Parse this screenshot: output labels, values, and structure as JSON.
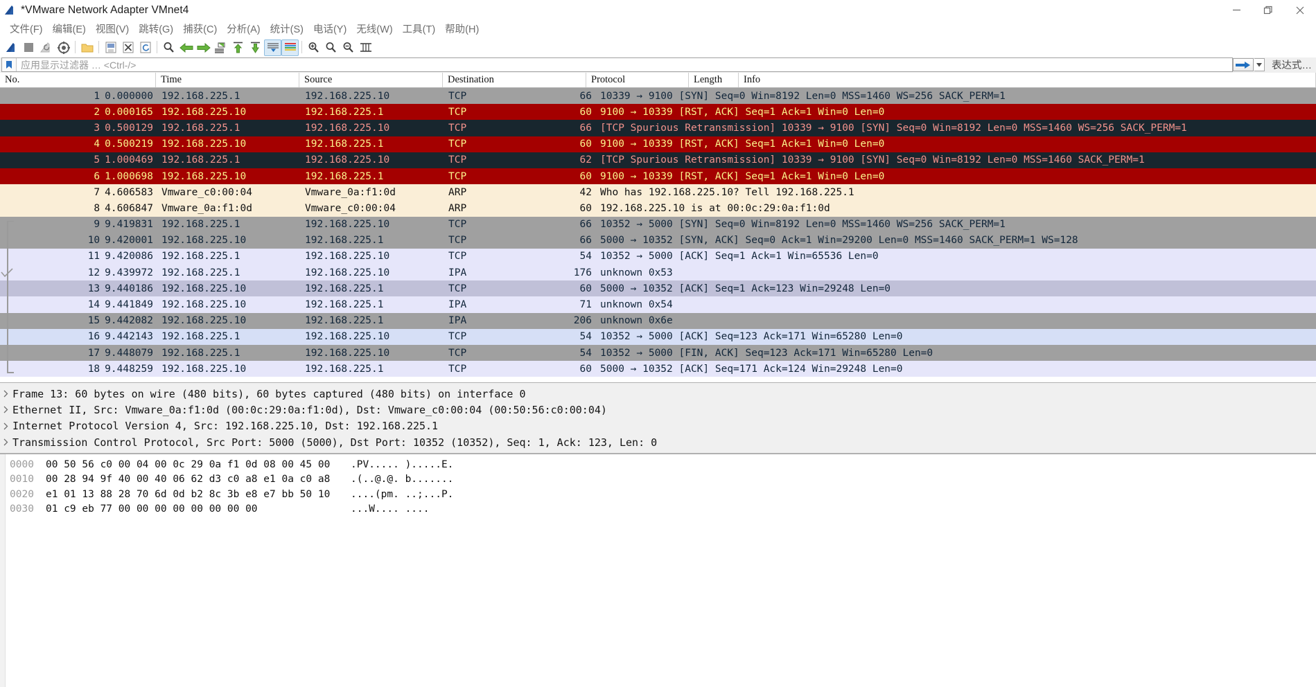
{
  "window": {
    "title": "*VMware Network Adapter VMnet4",
    "minimize_label": "minimize-icon",
    "restore_label": "restore-icon",
    "close_label": "close-icon"
  },
  "menu": {
    "items": [
      {
        "label": "文件(F)"
      },
      {
        "label": "编辑(E)"
      },
      {
        "label": "视图(V)"
      },
      {
        "label": "跳转(G)"
      },
      {
        "label": "捕获(C)"
      },
      {
        "label": "分析(A)"
      },
      {
        "label": "统计(S)"
      },
      {
        "label": "电话(Y)"
      },
      {
        "label": "无线(W)"
      },
      {
        "label": "工具(T)"
      },
      {
        "label": "帮助(H)"
      }
    ]
  },
  "toolbar": {
    "buttons": [
      {
        "name": "start-capture-icon"
      },
      {
        "name": "stop-capture-icon"
      },
      {
        "name": "restart-capture-icon"
      },
      {
        "name": "capture-options-icon"
      },
      {
        "name": "open-file-icon"
      },
      {
        "name": "save-file-icon"
      },
      {
        "name": "close-file-icon"
      },
      {
        "name": "reload-file-icon"
      },
      {
        "name": "find-packet-icon"
      },
      {
        "name": "go-back-icon"
      },
      {
        "name": "go-forward-icon"
      },
      {
        "name": "go-to-packet-icon"
      },
      {
        "name": "go-to-first-icon"
      },
      {
        "name": "go-to-last-icon"
      },
      {
        "name": "auto-scroll-icon"
      },
      {
        "name": "colorize-icon"
      },
      {
        "name": "zoom-in-icon"
      },
      {
        "name": "zoom-out-icon"
      },
      {
        "name": "zoom-reset-icon"
      },
      {
        "name": "resize-columns-icon"
      }
    ]
  },
  "filter": {
    "placeholder": "应用显示过滤器 … <Ctrl-/>",
    "value": "",
    "expression_label": "表达式…",
    "bookmark_icon": "bookmark-icon",
    "apply_icon": "apply-filter-arrow-icon",
    "dropdown_icon": "chevron-down-icon"
  },
  "packet_list": {
    "columns": [
      {
        "key": "no",
        "label": "No."
      },
      {
        "key": "time",
        "label": "Time"
      },
      {
        "key": "src",
        "label": "Source"
      },
      {
        "key": "dst",
        "label": "Destination"
      },
      {
        "key": "proto",
        "label": "Protocol"
      },
      {
        "key": "len",
        "label": "Length"
      },
      {
        "key": "info",
        "label": "Info"
      }
    ],
    "rows": [
      {
        "no": "1",
        "time": "0.000000",
        "src": "192.168.225.1",
        "dst": "192.168.225.10",
        "proto": "TCP",
        "len": "66",
        "info": "10339 → 9100 [SYN] Seq=0 Win=8192 Len=0 MSS=1460 WS=256 SACK_PERM=1",
        "bg": "#a0a0a0",
        "fg": "#12263a"
      },
      {
        "no": "2",
        "time": "0.000165",
        "src": "192.168.225.10",
        "dst": "192.168.225.1",
        "proto": "TCP",
        "len": "60",
        "info": "9100 → 10339 [RST, ACK] Seq=1 Ack=1 Win=0 Len=0",
        "bg": "#a40000",
        "fg": "#fbf38c"
      },
      {
        "no": "3",
        "time": "0.500129",
        "src": "192.168.225.1",
        "dst": "192.168.225.10",
        "proto": "TCP",
        "len": "66",
        "info": "[TCP Spurious Retransmission] 10339 → 9100 [SYN] Seq=0 Win=8192 Len=0 MSS=1460 WS=256 SACK_PERM=1",
        "bg": "#18262e",
        "fg": "#f2928c"
      },
      {
        "no": "4",
        "time": "0.500219",
        "src": "192.168.225.10",
        "dst": "192.168.225.1",
        "proto": "TCP",
        "len": "60",
        "info": "9100 → 10339 [RST, ACK] Seq=1 Ack=1 Win=0 Len=0",
        "bg": "#a40000",
        "fg": "#fbf38c"
      },
      {
        "no": "5",
        "time": "1.000469",
        "src": "192.168.225.1",
        "dst": "192.168.225.10",
        "proto": "TCP",
        "len": "62",
        "info": "[TCP Spurious Retransmission] 10339 → 9100 [SYN] Seq=0 Win=8192 Len=0 MSS=1460 SACK_PERM=1",
        "bg": "#18262e",
        "fg": "#f2928c"
      },
      {
        "no": "6",
        "time": "1.000698",
        "src": "192.168.225.10",
        "dst": "192.168.225.1",
        "proto": "TCP",
        "len": "60",
        "info": "9100 → 10339 [RST, ACK] Seq=1 Ack=1 Win=0 Len=0",
        "bg": "#a40000",
        "fg": "#fbf38c"
      },
      {
        "no": "7",
        "time": "4.606583",
        "src": "Vmware_c0:00:04",
        "dst": "Vmware_0a:f1:0d",
        "proto": "ARP",
        "len": "42",
        "info": "Who has 192.168.225.10? Tell 192.168.225.1",
        "bg": "#faeed7",
        "fg": "#111111"
      },
      {
        "no": "8",
        "time": "4.606847",
        "src": "Vmware_0a:f1:0d",
        "dst": "Vmware_c0:00:04",
        "proto": "ARP",
        "len": "60",
        "info": "192.168.225.10 is at 00:0c:29:0a:f1:0d",
        "bg": "#faeed7",
        "fg": "#111111"
      },
      {
        "no": "9",
        "time": "9.419831",
        "src": "192.168.225.1",
        "dst": "192.168.225.10",
        "proto": "TCP",
        "len": "66",
        "info": "10352 → 5000 [SYN] Seq=0 Win=8192 Len=0 MSS=1460 WS=256 SACK_PERM=1",
        "bg": "#a0a0a0",
        "fg": "#12263a"
      },
      {
        "no": "10",
        "time": "9.420001",
        "src": "192.168.225.10",
        "dst": "192.168.225.1",
        "proto": "TCP",
        "len": "66",
        "info": "5000 → 10352 [SYN, ACK] Seq=0 Ack=1 Win=29200 Len=0 MSS=1460 SACK_PERM=1 WS=128",
        "bg": "#a0a0a0",
        "fg": "#12263a"
      },
      {
        "no": "11",
        "time": "9.420086",
        "src": "192.168.225.1",
        "dst": "192.168.225.10",
        "proto": "TCP",
        "len": "54",
        "info": "10352 → 5000 [ACK] Seq=1 Ack=1 Win=65536 Len=0",
        "bg": "#e6e6fa",
        "fg": "#12263a"
      },
      {
        "no": "12",
        "time": "9.439972",
        "src": "192.168.225.1",
        "dst": "192.168.225.10",
        "proto": "IPA",
        "len": "176",
        "info": "unknown 0x53",
        "bg": "#e6e6fa",
        "fg": "#12263a"
      },
      {
        "no": "13",
        "time": "9.440186",
        "src": "192.168.225.10",
        "dst": "192.168.225.1",
        "proto": "TCP",
        "len": "60",
        "info": "5000 → 10352 [ACK] Seq=1 Ack=123 Win=29248 Len=0",
        "bg": "#c0c0d8",
        "fg": "#12263a"
      },
      {
        "no": "14",
        "time": "9.441849",
        "src": "192.168.225.10",
        "dst": "192.168.225.1",
        "proto": "IPA",
        "len": "71",
        "info": "unknown 0x54",
        "bg": "#e6e6fa",
        "fg": "#12263a"
      },
      {
        "no": "15",
        "time": "9.442082",
        "src": "192.168.225.10",
        "dst": "192.168.225.1",
        "proto": "IPA",
        "len": "206",
        "info": "unknown 0x6e",
        "bg": "#a0a0a0",
        "fg": "#12263a"
      },
      {
        "no": "16",
        "time": "9.442143",
        "src": "192.168.225.1",
        "dst": "192.168.225.10",
        "proto": "TCP",
        "len": "54",
        "info": "10352 → 5000 [ACK] Seq=123 Ack=171 Win=65280 Len=0",
        "bg": "#d6dff6",
        "fg": "#12263a"
      },
      {
        "no": "17",
        "time": "9.448079",
        "src": "192.168.225.1",
        "dst": "192.168.225.10",
        "proto": "TCP",
        "len": "54",
        "info": "10352 → 5000 [FIN, ACK] Seq=123 Ack=171 Win=65280 Len=0",
        "bg": "#a0a0a0",
        "fg": "#12263a"
      },
      {
        "no": "18",
        "time": "9.448259",
        "src": "192.168.225.10",
        "dst": "192.168.225.1",
        "proto": "TCP",
        "len": "60",
        "info": "5000 → 10352 [ACK] Seq=171 Ack=124 Win=29248 Len=0",
        "bg": "#e6e6fa",
        "fg": "#12263a"
      }
    ]
  },
  "packet_details": {
    "rows": [
      {
        "expander": "collapsed-triangle-icon",
        "text": "Frame 13: 60 bytes on wire (480 bits), 60 bytes captured (480 bits) on interface 0"
      },
      {
        "expander": "collapsed-triangle-icon",
        "text": "Ethernet II, Src: Vmware_0a:f1:0d (00:0c:29:0a:f1:0d), Dst: Vmware_c0:00:04 (00:50:56:c0:00:04)"
      },
      {
        "expander": "collapsed-triangle-icon",
        "text": "Internet Protocol Version 4, Src: 192.168.225.10, Dst: 192.168.225.1"
      },
      {
        "expander": "collapsed-triangle-icon",
        "text": "Transmission Control Protocol, Src Port: 5000 (5000), Dst Port: 10352 (10352), Seq: 1, Ack: 123, Len: 0"
      }
    ]
  },
  "packet_bytes": {
    "rows": [
      {
        "offset": "0000",
        "hex": "00 50 56 c0 00 04 00 0c  29 0a f1 0d 08 00 45 00",
        "ascii": ".PV..... ).....E."
      },
      {
        "offset": "0010",
        "hex": "00 28 94 9f 40 00 40 06  62 d3 c0 a8 e1 0a c0 a8",
        "ascii": ".(..@.@. b......."
      },
      {
        "offset": "0020",
        "hex": "e1 01 13 88 28 70 6d 0d  b2 8c 3b e8 e7 bb 50 10",
        "ascii": "....(pm. ..;...P."
      },
      {
        "offset": "0030",
        "hex": "01 c9 eb 77 00 00 00 00  00 00 00 00",
        "ascii": "...W.... ...."
      }
    ]
  }
}
